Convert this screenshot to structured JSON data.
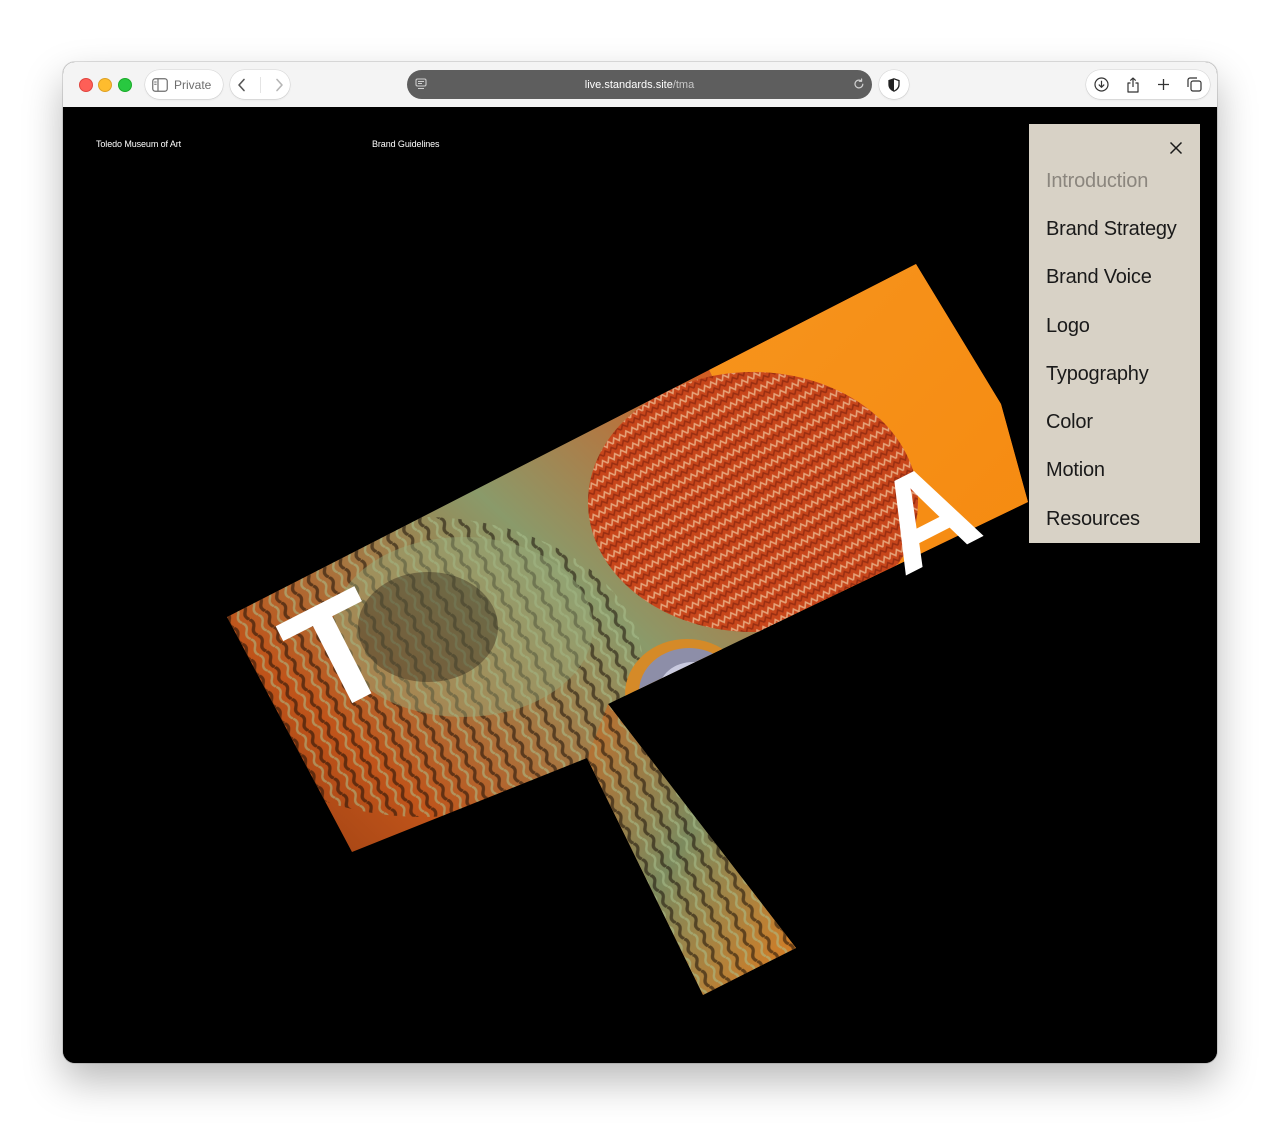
{
  "browser": {
    "private_label": "Private",
    "url_domain": "live.standards.site",
    "url_path": "/tma"
  },
  "site": {
    "name": "Toledo Museum of Art",
    "section": "Brand Guidelines"
  },
  "hero": {
    "letters": [
      "T",
      "A"
    ],
    "accent_color": "#f7941d"
  },
  "menu": {
    "background": "#d8d2c6",
    "active_index": 0,
    "items": [
      {
        "label": "Introduction"
      },
      {
        "label": "Brand Strategy"
      },
      {
        "label": "Brand Voice"
      },
      {
        "label": "Logo"
      },
      {
        "label": "Typography"
      },
      {
        "label": "Color"
      },
      {
        "label": "Motion"
      },
      {
        "label": "Resources"
      }
    ]
  }
}
